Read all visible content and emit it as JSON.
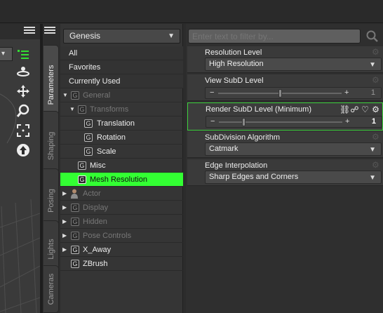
{
  "viewport": {
    "menu_icon": "menu-icon",
    "dropdown_caret": "▾",
    "tools": [
      "orbit-icon",
      "move-icon",
      "zoom-icon",
      "frame-icon",
      "up-arrow-icon"
    ]
  },
  "side_tabs": [
    {
      "label": "Parameters",
      "active": true
    },
    {
      "label": "Shaping",
      "active": false
    },
    {
      "label": "Posing",
      "active": false
    },
    {
      "label": "Lights",
      "active": false
    },
    {
      "label": "Cameras",
      "active": false
    }
  ],
  "node_selector": {
    "value": "Genesis",
    "caret": "▼"
  },
  "tree": {
    "headers": [
      "All",
      "Favorites",
      "Currently Used"
    ],
    "items": [
      {
        "label": "General",
        "icon": "G",
        "expander": "▼",
        "style": "dim"
      },
      {
        "label": "Transforms",
        "icon": "G",
        "expander": "▼",
        "style": "dim"
      },
      {
        "label": "Translation",
        "icon": "G",
        "expander": "",
        "style": "bright"
      },
      {
        "label": "Rotation",
        "icon": "G",
        "expander": "",
        "style": "bright"
      },
      {
        "label": "Scale",
        "icon": "G",
        "expander": "",
        "style": "bright"
      },
      {
        "label": "Misc",
        "icon": "G",
        "expander": "",
        "style": "bright"
      },
      {
        "label": "Mesh Resolution",
        "icon": "G",
        "expander": "",
        "style": "selected"
      },
      {
        "label": "Actor",
        "icon": "figure",
        "expander": "▶",
        "style": "dim"
      },
      {
        "label": "Display",
        "icon": "G",
        "expander": "▶",
        "style": "dim"
      },
      {
        "label": "Hidden",
        "icon": "G",
        "expander": "▶",
        "style": "dim"
      },
      {
        "label": "Pose Controls",
        "icon": "G",
        "expander": "▶",
        "style": "dim"
      },
      {
        "label": "X_Away",
        "icon": "G",
        "expander": "▶",
        "style": "bright"
      },
      {
        "label": "ZBrush",
        "icon": "G",
        "expander": "",
        "style": "bright"
      }
    ]
  },
  "filter": {
    "placeholder": "Enter text to filter by..."
  },
  "properties": [
    {
      "label": "Resolution Level",
      "kind": "combo",
      "value": "High Resolution",
      "caret": "▼"
    },
    {
      "label": "View SubD Level",
      "kind": "slider",
      "minus": "−",
      "plus": "+",
      "value": "1",
      "level": 0.5
    },
    {
      "label": "Render SubD Level (Minimum)",
      "kind": "slider",
      "minus": "−",
      "plus": "+",
      "value": "1",
      "level": 0.2,
      "focused": true,
      "icons": [
        "link-icon",
        "nodes-icon",
        "heart-icon",
        "gear-icon"
      ]
    },
    {
      "label": "SubDivision Algorithm",
      "kind": "combo",
      "value": "Catmark",
      "caret": "▼"
    },
    {
      "label": "Edge Interpolation",
      "kind": "combo",
      "value": "Sharp Edges and Corners",
      "caret": "▼"
    }
  ],
  "colors": {
    "selection": "#33ff33",
    "focus_border": "#3ed13e"
  }
}
